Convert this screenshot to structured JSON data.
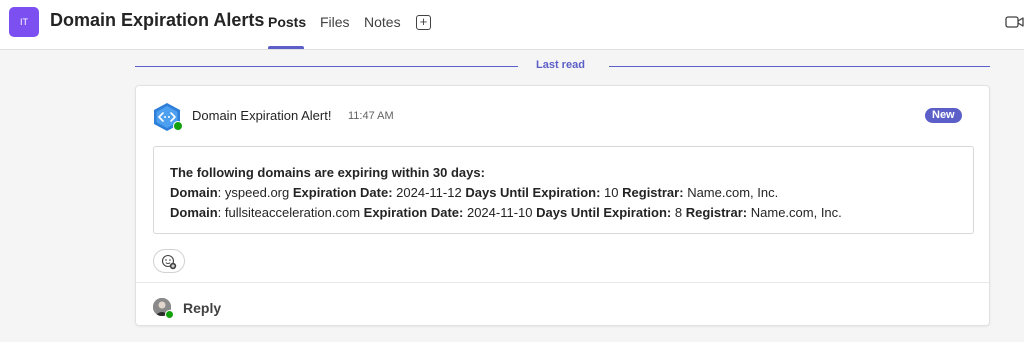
{
  "header": {
    "team_initials": "IT",
    "channel_title": "Domain Expiration Alerts",
    "tabs": [
      {
        "label": "Posts",
        "active": true
      },
      {
        "label": "Files",
        "active": false
      },
      {
        "label": "Notes",
        "active": false
      }
    ],
    "add_tab_icon": "plus-square-icon",
    "meet_icon": "video-camera-icon"
  },
  "divider": {
    "label": "Last read"
  },
  "message": {
    "sender": "Domain Expiration Alert!",
    "time": "11:47 AM",
    "badge": "New",
    "intro": "The following domains are expiring within 30 days:",
    "field_labels": {
      "domain": "Domain",
      "expiration": "Expiration Date:",
      "days": "Days Until Expiration:",
      "registrar": "Registrar:"
    },
    "domains": [
      {
        "domain": "yspeed.org",
        "expiration": "2024-11-12",
        "days": "10",
        "registrar": "Name.com, Inc."
      },
      {
        "domain": "fullsiteacceleration.com",
        "expiration": "2024-11-10",
        "days": "8",
        "registrar": "Name.com, Inc."
      }
    ]
  },
  "reply": {
    "label": "Reply"
  },
  "colors": {
    "accent": "#5b5fc7",
    "team_avatar": "#7b4ff0",
    "presence_online": "#13a10e"
  }
}
